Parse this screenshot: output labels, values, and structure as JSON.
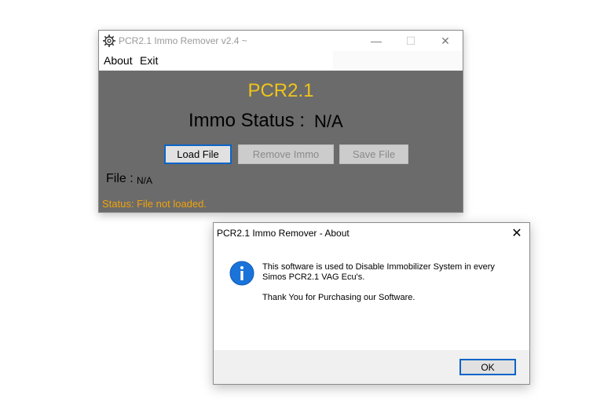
{
  "main_window": {
    "title": "PCR2.1 Immo Remover v2.4 ~",
    "caption": {
      "minimize": "—",
      "maximize": "☐",
      "close": "✕"
    },
    "menu": {
      "about": "About",
      "exit": "Exit"
    },
    "app_title": "PCR2.1",
    "immo_status_label": "Immo Status :",
    "immo_status_value": "N/A",
    "buttons": {
      "load": "Load File",
      "remove": "Remove Immo",
      "save": "Save File"
    },
    "file_label": "File :",
    "file_value": "N/A",
    "status": "Status: File not loaded.",
    "colors": {
      "background": "#6b6b6b",
      "title_accent": "#f0c419",
      "status": "#f0a30a"
    }
  },
  "about_dialog": {
    "title": "PCR2.1 Immo Remover - About",
    "close": "✕",
    "icon": "info-icon",
    "message_line1": "This software is used to Disable Immobilizer System in every",
    "message_line2": "Simos PCR2.1 VAG Ecu's.",
    "message_line3": "Thank You for Purchasing our Software.",
    "ok_label": "OK"
  }
}
